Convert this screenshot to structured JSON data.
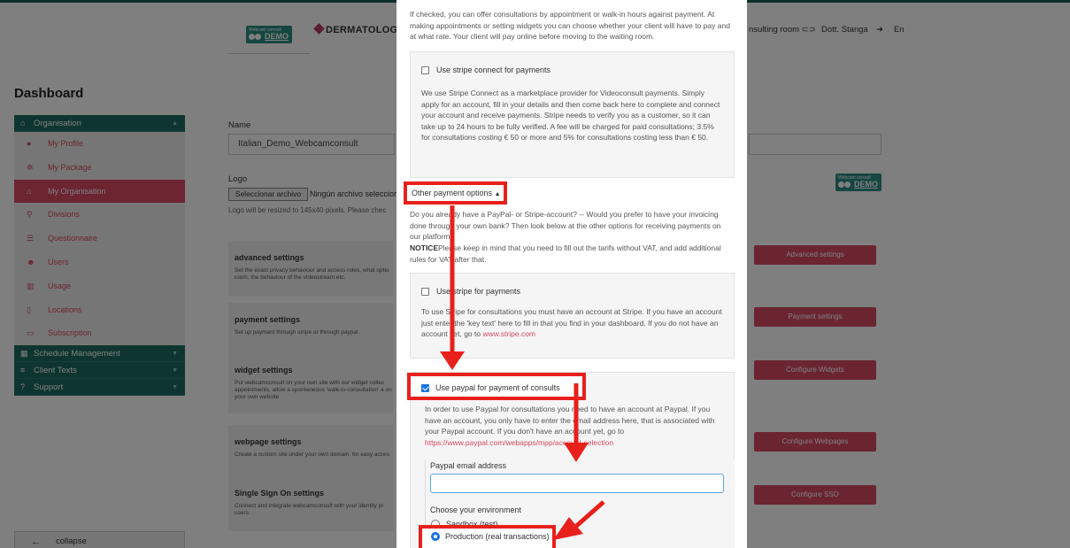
{
  "header": {
    "logo_top": "Webcam consult",
    "logo_demo": "DEMO",
    "brand": "DERMATOLOGY",
    "consulting_room": "nsulting room",
    "user": "Dott. Stanga",
    "lang": "En"
  },
  "dashboard": {
    "title": "Dashboard",
    "collapse": "collapse"
  },
  "sidebar": {
    "organisation": "Organisation",
    "items": [
      {
        "label": "My Profile",
        "icon": "person-icon"
      },
      {
        "label": "My Package",
        "icon": "cogs-icon"
      },
      {
        "label": "My Organisation",
        "icon": "bank-icon"
      },
      {
        "label": "Divisions",
        "icon": "sitemap-icon"
      },
      {
        "label": "Questionnaire",
        "icon": "list-icon"
      },
      {
        "label": "Users",
        "icon": "users-icon"
      },
      {
        "label": "Usage",
        "icon": "chart-icon"
      },
      {
        "label": "Locations",
        "icon": "map-icon"
      },
      {
        "label": "Subscription",
        "icon": "card-icon"
      }
    ],
    "schedule": "Schedule Management",
    "client_texts": "Client Texts",
    "support": "Support"
  },
  "form": {
    "name_label": "Name",
    "name_value": "Italian_Demo_Webcamconsult",
    "logo_label": "Logo",
    "file_button": "Seleccionar archivo",
    "file_status": "Ningún archivo seleccior",
    "logo_note": "Logo will be resized to 145x40 pixels. Please chec"
  },
  "cards": [
    {
      "title": "advanced settings",
      "desc": "Set the exact privacy behaviour and access roles, what optio room, the behaviour of the videostream etc.",
      "button": "Advanced settings"
    },
    {
      "title": "payment settings",
      "desc": "Set up payment through stripe or through paypal.",
      "button": "Payment settings"
    },
    {
      "title": "widget settings",
      "desc": "Put webcamconsult on your own site with our widget collec appointments, allow a sponteneous 'walk-in-consultation' a on your own website",
      "button": "Configure Widgets"
    },
    {
      "title": "webpage settings",
      "desc": "Create a custom site onder your own domain, for easy acces",
      "button": "Configure Webpages"
    },
    {
      "title": "Single Sign On settings",
      "desc": "Connect and integrate webcamconsult with your identity pr users.",
      "button": "Configure SSO"
    }
  ],
  "modal": {
    "intro": "If checked, you can offer consultations by appointment or walk-in hours against payment. At making appointments or setting widgets you can choose whether your client will have to pay and at what rate. Your client will pay online before moving to the waiting room.",
    "stripe_connect_label": "Use stripe connect for payments",
    "stripe_connect_text": "We use Stripe Connect as a marketplace provider for Videoconsult payments. Simply apply for an account, fill in your details and then come back here to complete and connect your account and receive payments. Stripe needs to verify you as a customer, so it can take up to 24 hours to be fully verified. A fee will be charged for paid consultations; 3.5% for consultations costing € 50 or more and 5% for consultations costing less than € 50.",
    "other_options": "Other payment options",
    "other_text": "Do you already have a PayPal- or Stripe-account? -- Would you prefer to have your invoicing done through your own bank? Then look below at the other options for receiving payments on our platform.",
    "notice_bold": "NOTICE",
    "notice_text": "Please keep in mind that you need to fill out the tarifs without VAT, and add additional rules for VAT after that.",
    "stripe_label": "Use stripe for payments",
    "stripe_text": "To use Stripe for consultations you must have an account at Stripe. If you have an account just enter the 'key text' here to fill in that you find in your dashboard. If you do not have an account yet, go to",
    "stripe_link": "www.stripe.com",
    "paypal_label": "Use paypal for payment of consults",
    "paypal_text": "In order to use Paypal for consultations you need to have an account at Paypal. If you have an account, you only have to enter the email address here, that is associated with your Paypal account. If you don't have an account yet, go to",
    "paypal_link": "https://www.paypal.com/webapps/mpp/account-selection",
    "paypal_email_label": "Paypal email address",
    "paypal_email_value": "",
    "env_label": "Choose your environment",
    "env_sandbox": "Sandbox (test)",
    "env_production": "Production (real transactions)"
  },
  "colors": {
    "teal": "#1f6b61",
    "accent": "#d64a63",
    "highlight": "#e8201c"
  }
}
